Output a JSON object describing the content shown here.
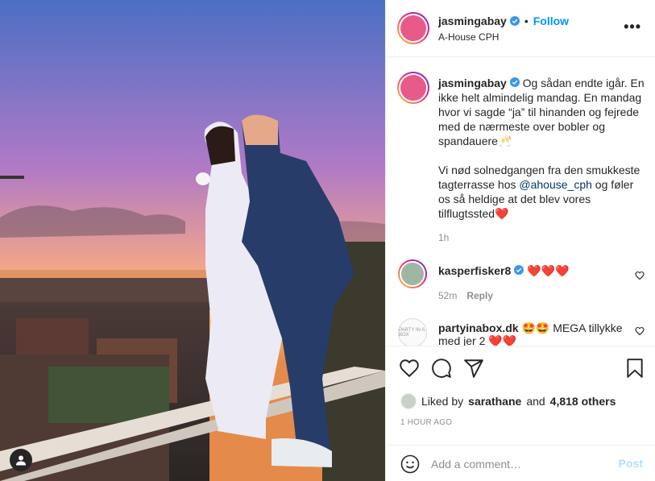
{
  "post": {
    "author": "jasmingabay",
    "location": "A-House CPH",
    "follow_label": "Follow",
    "dot": "•",
    "more_label": "•••",
    "caption_lines": [
      "Og sådan endte igår. En ikke helt almindelig mandag. En mandag hvor vi sagde “ja” til hinanden og fejrede med de nærmeste over bobler og spandauere🥂"
    ],
    "caption_p2_before": "Vi nød solnedgangen fra den smukkeste tagterrasse hos ",
    "caption_mention": "@ahouse_cph",
    "caption_p2_after": " og føler os så heldige at det blev vores tilflugtssted",
    "caption_heart": "❤️",
    "caption_time": "1h"
  },
  "comments": [
    {
      "user": "kasperfisker8",
      "text": "❤️❤️❤️",
      "time": "52m",
      "reply_label": "Reply"
    },
    {
      "user": "partyinabox.dk",
      "text": "🤩🤩 MEGA tillykke med jer 2 ❤️❤️",
      "avatar_text": "PARTY IN A BOX"
    }
  ],
  "likes": {
    "prefix": "Liked by",
    "liker": "sarathane",
    "and": "and",
    "others": "4,818 others"
  },
  "time_ago": "1 HOUR AGO",
  "comment_box": {
    "placeholder": "Add a comment…",
    "post_label": "Post"
  },
  "colors": {
    "accent": "#0095f6",
    "verified": "#3897f0",
    "heart": "#e0112b",
    "muted": "#8e8e8e"
  },
  "icons": [
    "user-tag-icon",
    "verified-icon",
    "more-icon",
    "heart-icon",
    "comment-icon",
    "share-icon",
    "bookmark-icon",
    "emoji-icon"
  ]
}
